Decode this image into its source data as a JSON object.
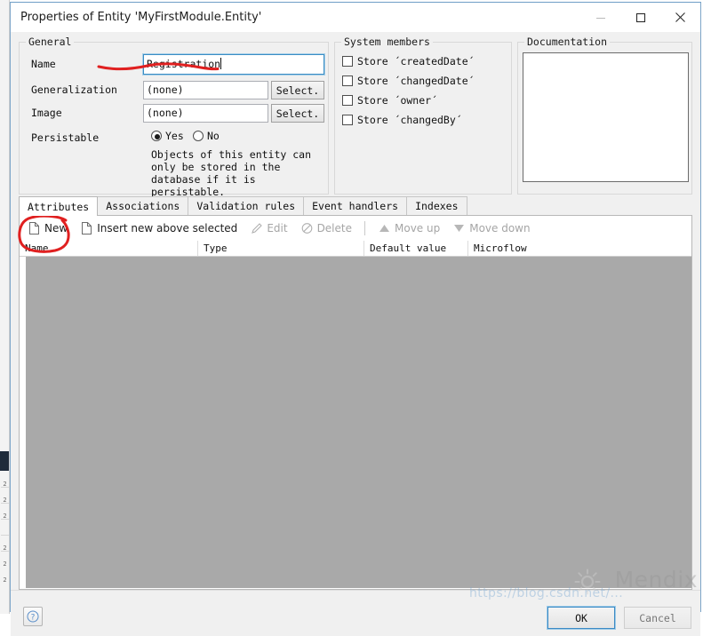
{
  "window": {
    "title": "Properties of Entity 'MyFirstModule.Entity'",
    "minimize_label": "minimize-icon",
    "maximize_label": "maximize-icon",
    "close_label": "close-icon"
  },
  "general": {
    "legend": "General",
    "name_label": "Name",
    "name_value": "Registration",
    "generalization_label": "Generalization",
    "generalization_value": "(none)",
    "generalization_button": "Select.",
    "image_label": "Image",
    "image_value": "(none)",
    "image_button": "Select.",
    "persistable_label": "Persistable",
    "persistable_yes": "Yes",
    "persistable_no": "No",
    "persistable_selected": "Yes",
    "persistable_help": "Objects of this entity can only be stored in the database if it is persistable."
  },
  "system_members": {
    "legend": "System members",
    "items": [
      {
        "label": "Store ´createdDate´",
        "checked": false
      },
      {
        "label": "Store ´changedDate´",
        "checked": false
      },
      {
        "label": "Store ´owner´",
        "checked": false
      },
      {
        "label": "Store ´changedBy´",
        "checked": false
      }
    ]
  },
  "documentation": {
    "legend": "Documentation",
    "value": "",
    "scroll_up": "▲",
    "scroll_down": "▼"
  },
  "tabs": [
    {
      "label": "Attributes",
      "active": true
    },
    {
      "label": "Associations",
      "active": false
    },
    {
      "label": "Validation rules",
      "active": false
    },
    {
      "label": "Event handlers",
      "active": false
    },
    {
      "label": "Indexes",
      "active": false
    }
  ],
  "toolbar": [
    {
      "label": "New",
      "icon": "new-document-icon",
      "enabled": true
    },
    {
      "label": "Insert new above selected",
      "icon": "insert-document-icon",
      "enabled": true
    },
    {
      "label": "Edit",
      "icon": "pencil-icon",
      "enabled": false
    },
    {
      "label": "Delete",
      "icon": "delete-circle-icon",
      "enabled": false
    },
    {
      "label": "Move up",
      "icon": "triangle-up-icon",
      "enabled": false
    },
    {
      "label": "Move down",
      "icon": "triangle-down-icon",
      "enabled": false
    }
  ],
  "grid": {
    "columns": [
      "Name",
      "Type",
      "Default value",
      "Microflow"
    ],
    "rows": []
  },
  "footer": {
    "help_label": "?",
    "ok_label": "OK",
    "cancel_label": "Cancel"
  },
  "watermarks": {
    "url": "https://blog.csdn.net/...",
    "brand": "Mendix"
  },
  "colors": {
    "accent_blue": "#3c8ac4",
    "annotation_red": "#e02020",
    "grid_body_gray": "#a9a9a9",
    "dialog_face": "#f0f0f0"
  }
}
